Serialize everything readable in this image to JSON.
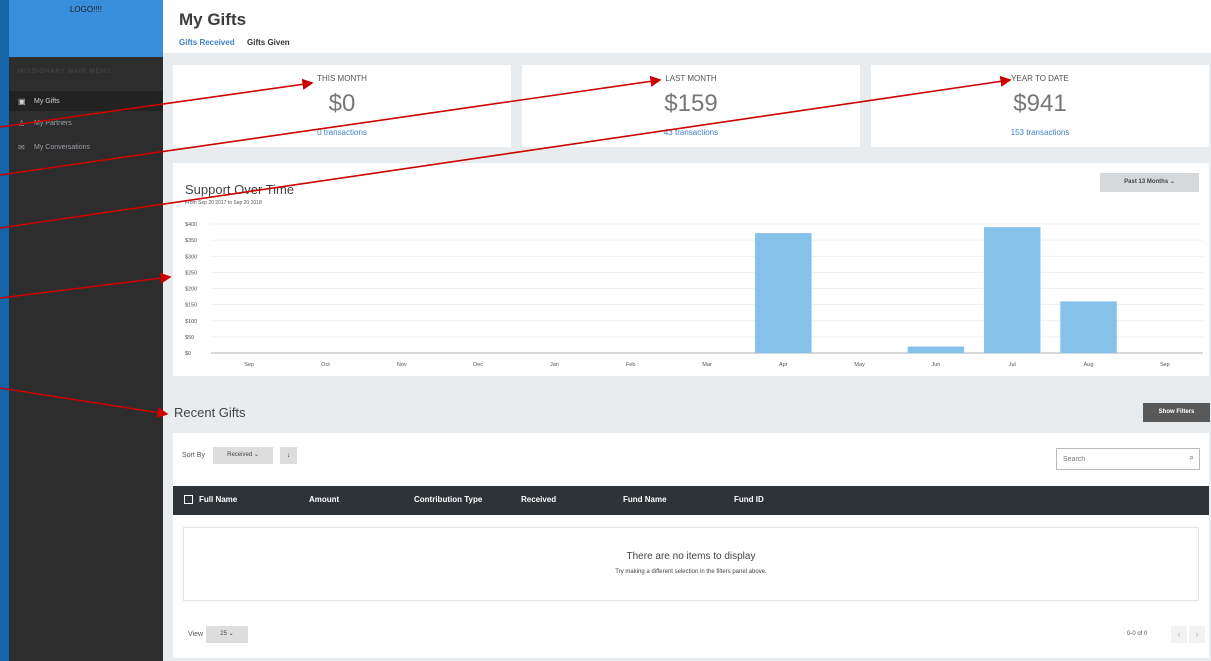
{
  "sidebar": {
    "logo": "LOGO!!!!",
    "menu_heading": "MISSIONARY MAIN MENU",
    "items": [
      {
        "label": "My Gifts",
        "icon": "gift-icon",
        "active": true
      },
      {
        "label": "My Partners",
        "icon": "people-icon",
        "active": false
      },
      {
        "label": "My Conversations",
        "icon": "envelope-icon",
        "active": false
      }
    ]
  },
  "header": {
    "title": "My Gifts",
    "tabs": [
      "Gifts Received",
      "Gifts Given"
    ]
  },
  "stats": [
    {
      "label": "THIS MONTH",
      "value": "$0",
      "transactions": "0 transactions"
    },
    {
      "label": "LAST MONTH",
      "value": "$159",
      "transactions": "43 transactions"
    },
    {
      "label": "YEAR TO DATE",
      "value": "$941",
      "transactions": "153 transactions"
    }
  ],
  "chart_panel": {
    "period_button": "Past 13 Months"
  },
  "chart_data": {
    "type": "bar",
    "title": "Support Over Time",
    "subtitle": "From Sep 20 2017 to Sep 20 2018",
    "categories": [
      "Sep",
      "Oct",
      "Nov",
      "Dec",
      "Jan",
      "Feb",
      "Mar",
      "Apr",
      "May",
      "Jun",
      "Jul",
      "Aug",
      "Sep"
    ],
    "values": [
      0,
      0,
      0,
      0,
      0,
      0,
      0,
      372,
      0,
      20,
      390,
      160,
      0
    ],
    "ylim": [
      0,
      400
    ],
    "yticks": [
      "$0",
      "$50",
      "$100",
      "$150",
      "$200",
      "$250",
      "$300",
      "$350",
      "$400"
    ],
    "bar_color": "#85c1e9",
    "grid": true
  },
  "recent": {
    "title": "Recent Gifts",
    "filters_button": "Show Filters",
    "sort_label": "Sort By",
    "sort_value": "Received",
    "sort_direction_icon": "↓",
    "search_placeholder": "Search",
    "columns": [
      "Full Name",
      "Amount",
      "Contribution Type",
      "Received",
      "Fund Name",
      "Fund ID"
    ],
    "empty_title": "There are no items to display",
    "empty_subtitle": "Try making a different selection in the filters panel above.",
    "view_label": "View",
    "view_value": "25",
    "range_text": "0-0 of 0"
  },
  "colors": {
    "accent": "#3f7fc7",
    "sidebar_bg": "#2d2d2d",
    "logo_bg": "#3a8fdd",
    "table_header_bg": "#2e3338",
    "annotation_arrow": "#cc0000"
  }
}
